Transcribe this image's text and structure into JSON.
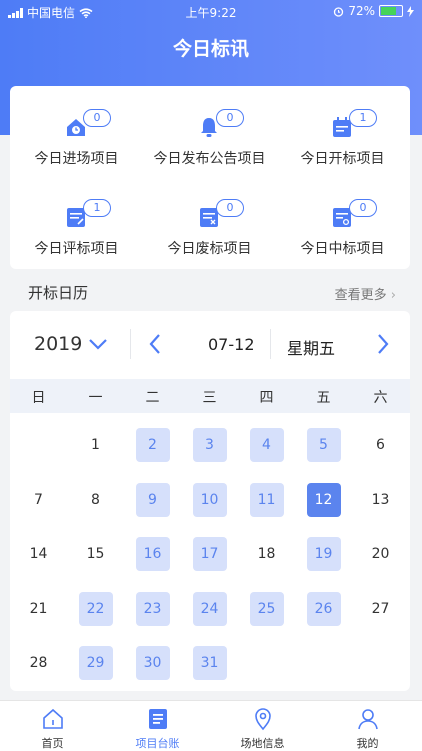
{
  "status_bar": {
    "carrier": "中国电信",
    "time": "上午9:22",
    "battery": "72%"
  },
  "page": {
    "title": "今日标讯"
  },
  "stats": [
    {
      "label": "今日进场项目",
      "count": "0",
      "icon": "house-clock-icon"
    },
    {
      "label": "今日发布公告项目",
      "count": "0",
      "icon": "bell-icon"
    },
    {
      "label": "今日开标项目",
      "count": "1",
      "icon": "calendar-icon"
    },
    {
      "label": "今日评标项目",
      "count": "1",
      "icon": "doc-edit-icon"
    },
    {
      "label": "今日废标项目",
      "count": "0",
      "icon": "doc-cancel-icon"
    },
    {
      "label": "今日中标项目",
      "count": "0",
      "icon": "doc-award-icon"
    }
  ],
  "calendar_section": {
    "title": "开标日历",
    "more": "查看更多"
  },
  "calendar": {
    "year": "2019",
    "date": "07-12",
    "weekday": "星期五",
    "week_headers": [
      "日",
      "一",
      "二",
      "三",
      "四",
      "五",
      "六"
    ],
    "first_weekday_index": 1,
    "days_in_month": 31,
    "marked_days": [
      2,
      3,
      4,
      5,
      9,
      10,
      11,
      16,
      17,
      19,
      22,
      23,
      24,
      25,
      26,
      29,
      30,
      31
    ],
    "selected_day": 12
  },
  "colors": {
    "accent": "#4e7cf6",
    "marked_bg": "#d6e0fb",
    "selected_bg": "#5b84ee"
  },
  "tabs": [
    {
      "label": "首页",
      "icon": "home-icon"
    },
    {
      "label": "项目台账",
      "icon": "ledger-icon",
      "active": true
    },
    {
      "label": "场地信息",
      "icon": "location-pin-icon"
    },
    {
      "label": "我的",
      "icon": "user-icon"
    }
  ]
}
